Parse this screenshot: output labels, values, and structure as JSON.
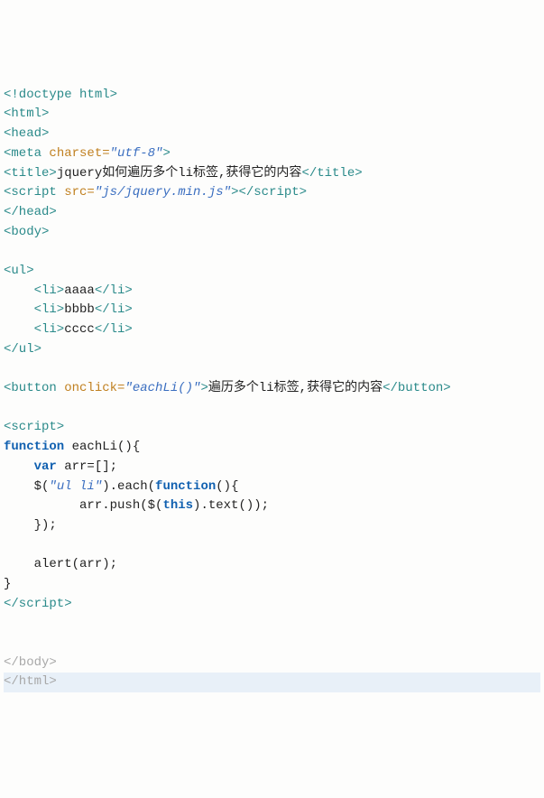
{
  "lines": {
    "l1_tag": "<!doctype html>",
    "l2_tag": "<html>",
    "l3_tag": "<head>",
    "l4_open": "<meta ",
    "l4_attr": "charset=",
    "l4_val": "\"utf-8\"",
    "l4_close": ">",
    "l5_open": "<title>",
    "l5_text": "jquery如何遍历多个li标签,获得它的内容",
    "l5_close": "</title>",
    "l6_open": "<script ",
    "l6_attr": "src=",
    "l6_val": "\"js/jquery.min.js\"",
    "l6_mid": ">",
    "l6_close2": "</script>",
    "l7_tag": "</head>",
    "l8_tag": "<body>",
    "l10_tag": "<ul>",
    "l11_open": "    <li>",
    "l11_text": "aaaa",
    "l11_close": "</li>",
    "l12_open": "    <li>",
    "l12_text": "bbbb",
    "l12_close": "</li>",
    "l13_open": "    <li>",
    "l13_text": "cccc",
    "l13_close": "</li>",
    "l14_tag": "</ul>",
    "l16_open": "<button ",
    "l16_attr": "onclick=",
    "l16_val": "\"eachLi()\"",
    "l16_mid": ">",
    "l16_text": "遍历多个li标签,获得它的内容",
    "l16_close": "</button>",
    "l18_tag": "<script>",
    "l19_kw": "function",
    "l19_rest": " eachLi(){",
    "l20_pre": "    ",
    "l20_kw": "var",
    "l20_rest": " arr=[];",
    "l21_pre": "    $(",
    "l21_str": "\"ul li\"",
    "l21_mid": ").each(",
    "l21_kw": "function",
    "l21_end": "(){",
    "l22_pre": "          arr.push($(",
    "l22_kw": "this",
    "l22_end": ").text());",
    "l23": "    });",
    "l25": "    alert(arr);",
    "l26": "}",
    "l27_tag": "</script>",
    "l30_tag": "</body>",
    "l31_tag": "</html>"
  }
}
